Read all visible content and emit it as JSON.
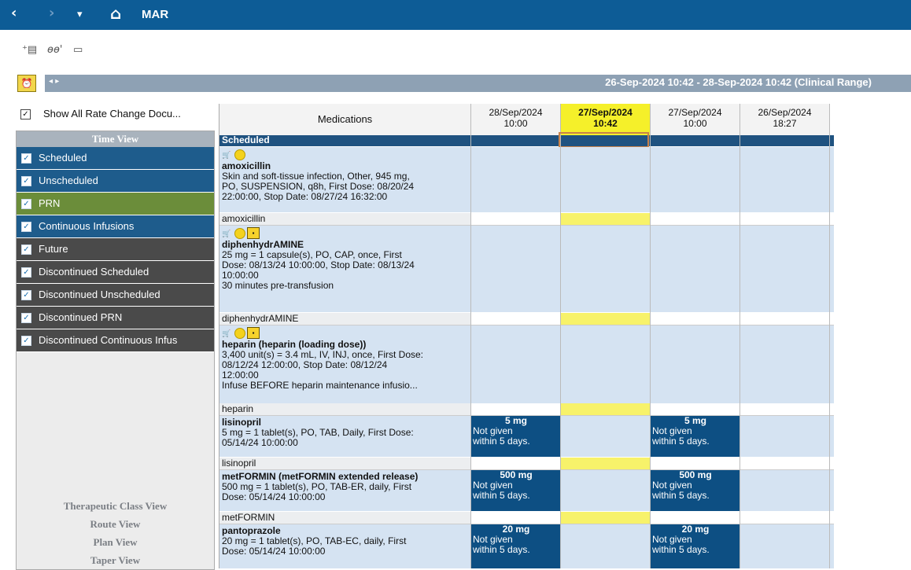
{
  "titlebar": {
    "title": "MAR",
    "back": "‹",
    "forward": "›",
    "dropdown": "▾",
    "home": "⌂"
  },
  "toolbar": {
    "icons": [
      "add-order-icon",
      "glasses-icon",
      "document-icon"
    ]
  },
  "range": {
    "text": "26-Sep-2024 10:42 - 28-Sep-2024 10:42 (Clinical Range)",
    "alarm": "⏰",
    "arrows": "◂ ▸"
  },
  "show_all": {
    "label": "Show All Rate Change Docu..."
  },
  "time_view": {
    "header": "Time View",
    "items": [
      {
        "label": "Scheduled"
      },
      {
        "label": "Unscheduled"
      },
      {
        "label": "PRN"
      },
      {
        "label": "Continuous Infusions"
      },
      {
        "label": "Future"
      },
      {
        "label": "Discontinued Scheduled"
      },
      {
        "label": "Discontinued Unscheduled"
      },
      {
        "label": "Discontinued PRN"
      },
      {
        "label": "Discontinued Continuous Infus"
      }
    ]
  },
  "views": [
    "Therapeutic Class View",
    "Route View",
    "Plan View",
    "Taper View"
  ],
  "grid": {
    "med_header": "Medications",
    "columns": [
      {
        "date": "28/Sep/2024",
        "time": "10:00"
      },
      {
        "date": "27/Sep/2024",
        "time": "10:42"
      },
      {
        "date": "27/Sep/2024",
        "time": "10:00"
      },
      {
        "date": "26/Sep/2024",
        "time": "18:27"
      }
    ],
    "section": "Scheduled",
    "orders": [
      {
        "name": "amoxicillin",
        "l1": "Skin and soft-tissue infection, Other, 945 mg,",
        "l2": "PO, SUSPENSION, q8h, First Dose: 08/20/24",
        "l3": "22:00:00, Stop Date: 08/27/24 16:32:00",
        "label": "amoxicillin"
      },
      {
        "name": "diphenhydrAMINE",
        "l1": "25 mg = 1 capsule(s), PO, CAP, once, First",
        "l2": "Dose: 08/13/24 10:00:00, Stop Date: 08/13/24",
        "l3": "10:00:00",
        "l4": "30 minutes pre-transfusion",
        "label": "diphenhydrAMINE"
      },
      {
        "name": "heparin (heparin (loading dose))",
        "l1": "3,400 unit(s) = 3.4 mL, IV, INJ, once, First Dose:",
        "l2": "08/12/24 12:00:00, Stop Date: 08/12/24",
        "l3": "12:00:00",
        "l4": "Infuse BEFORE heparin maintenance infusio...",
        "label": "heparin"
      },
      {
        "name": "lisinopril",
        "l1": "5 mg = 1 tablet(s), PO, TAB, Daily, First Dose:",
        "l2": "05/14/24 10:00:00",
        "label": "lisinopril",
        "dose": "5 mg",
        "ng1": "Not given",
        "ng2": "within 5 days."
      },
      {
        "name": "metFORMIN (metFORMIN extended release)",
        "l1": "500 mg = 1 tablet(s), PO, TAB-ER, daily, First",
        "l2": "Dose: 05/14/24 10:00:00",
        "label": "metFORMIN",
        "dose": "500 mg",
        "ng1": "Not given",
        "ng2": "within 5 days."
      },
      {
        "name": "pantoprazole",
        "l1": "20 mg = 1 tablet(s), PO, TAB-EC, daily, First",
        "l2": "Dose: 05/14/24 10:00:00",
        "dose": "20 mg",
        "ng1": "Not given",
        "ng2": "within 5 days."
      }
    ]
  }
}
